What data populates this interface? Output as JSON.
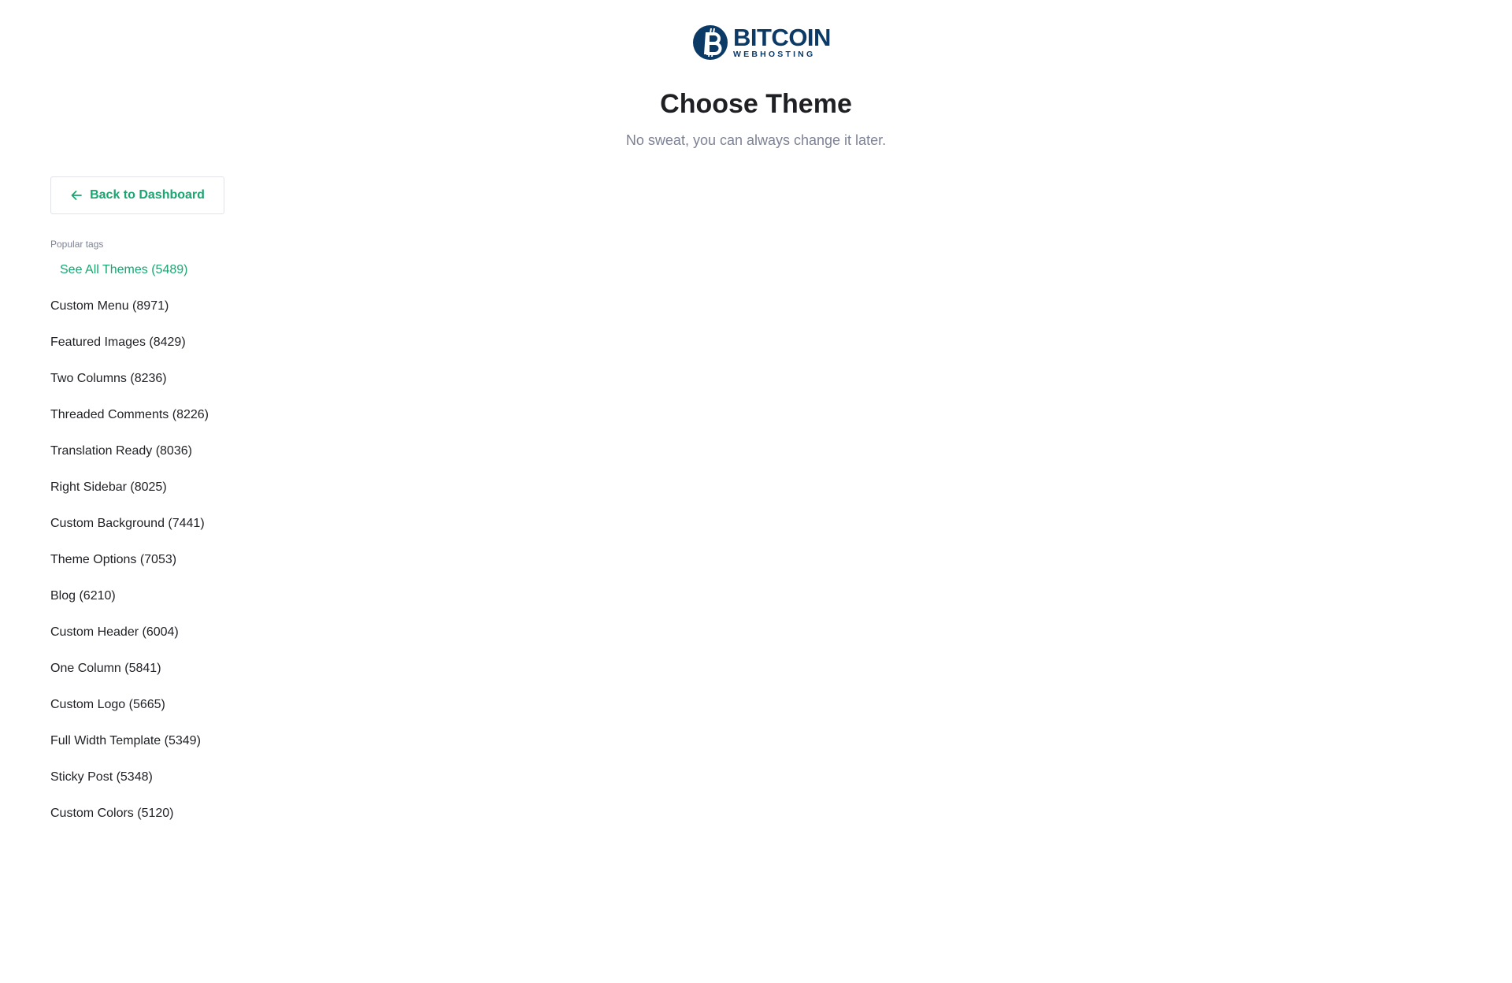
{
  "logo": {
    "name": "BITCOIN",
    "sub": "WEBHOSTING"
  },
  "header": {
    "title": "Choose Theme",
    "subtitle": "No sweat, you can always change it later."
  },
  "sidebar": {
    "back_label": "Back to Dashboard",
    "tags_label": "Popular tags",
    "tags": [
      "See All Themes (5489)",
      "Custom Menu (8971)",
      "Featured Images (8429)",
      "Two Columns (8236)",
      "Threaded Comments (8226)",
      "Translation Ready (8036)",
      "Right Sidebar (8025)",
      "Custom Background (7441)",
      "Theme Options (7053)",
      "Blog (6210)",
      "Custom Header (6004)",
      "One Column (5841)",
      "Custom Logo (5665)",
      "Full Width Template (5349)",
      "Sticky Post (5348)",
      "Custom Colors (5120)"
    ]
  },
  "colors": {
    "accent": "#1aa571",
    "brand": "#0c3a67",
    "text": "#1f2024",
    "muted": "#7d8294"
  },
  "icons": {
    "back": "arrow-left-icon",
    "logo": "bitcoin-logo-icon"
  }
}
